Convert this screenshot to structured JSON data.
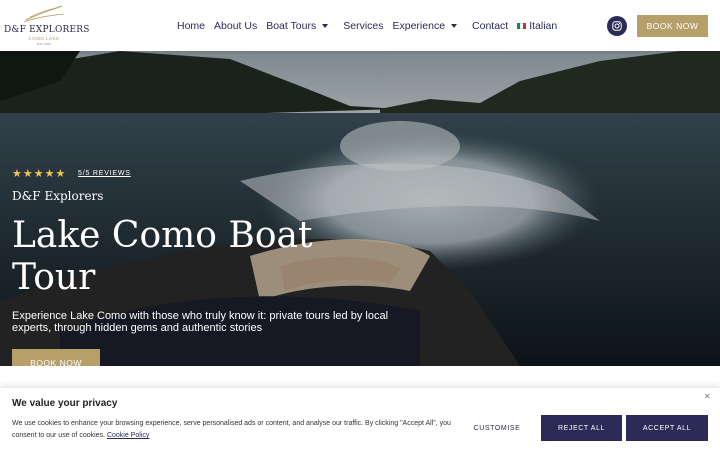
{
  "header": {
    "logo": {
      "name": "D&F EXPLORERS",
      "subtitle": "COMO LAKE",
      "established": "EST. 2021"
    },
    "nav": [
      {
        "label": "Home"
      },
      {
        "label": "About Us"
      },
      {
        "label": "Boat Tours"
      },
      {
        "label": "Services"
      },
      {
        "label": "Experience"
      },
      {
        "label": "Contact"
      },
      {
        "label": "Italian"
      }
    ],
    "book_label": "BOOK NOW",
    "instagram_icon": "instagram-icon"
  },
  "hero": {
    "rating_stars": 5,
    "reviews_label": "5/5 REVIEWS",
    "brand": "D&F Explorers",
    "title": "Lake Como Boat Tour",
    "description": "Experience Lake Como with those who truly know it: private tours led by local experts, through hidden gems and authentic stories",
    "book_label": "BOOK NOW"
  },
  "cookie": {
    "title": "We value your privacy",
    "text": "We use cookies to enhance your browsing experience, serve personalised ads or content, and analyse our traffic. By clicking \"Accept All\", you consent to our use of cookies.",
    "policy_link": "Cookie Policy",
    "customise_label": "CUSTOMISE",
    "reject_label": "REJECT ALL",
    "accept_label": "ACCEPT ALL"
  },
  "colors": {
    "navy": "#2c2b57",
    "gold": "#b79f6a",
    "star": "#f0c34a"
  }
}
